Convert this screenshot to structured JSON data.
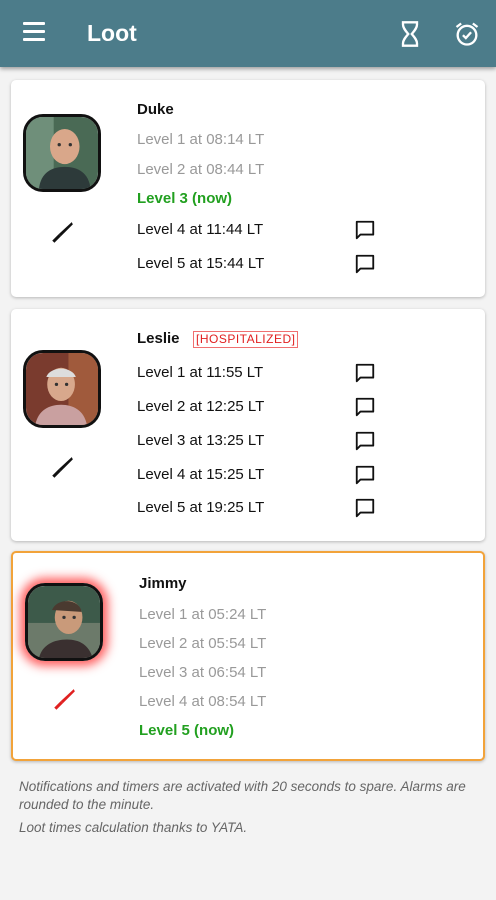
{
  "appbar": {
    "title": "Loot",
    "icons": {
      "menu": "menu-icon",
      "timer": "hourglass-icon",
      "alarm": "alarm-clock-icon"
    },
    "color": "#4c7c8a"
  },
  "colors": {
    "past": "#999999",
    "now": "#22a020",
    "hospitalized": "#e02020",
    "highlight_border": "#f2a33a"
  },
  "npcs": [
    {
      "name": "Duke",
      "badge": "",
      "levels": [
        {
          "label": "Level 1 at 08:14 LT",
          "state": "past"
        },
        {
          "label": "Level 2 at 08:44 LT",
          "state": "past"
        },
        {
          "label": "Level 3 (now)",
          "state": "now"
        },
        {
          "label": "Level 4 at 11:44 LT",
          "state": "future",
          "notify_icon": "chat-bubble-icon"
        },
        {
          "label": "Level 5 at 15:44 LT",
          "state": "future",
          "notify_icon": "chat-bubble-icon"
        }
      ]
    },
    {
      "name": "Leslie",
      "badge": "[HOSPITALIZED]",
      "levels": [
        {
          "label": "Level 1 at 11:55 LT",
          "state": "future",
          "notify_icon": "chat-bubble-icon"
        },
        {
          "label": "Level 2 at 12:25 LT",
          "state": "future",
          "notify_icon": "chat-bubble-icon"
        },
        {
          "label": "Level 3 at 13:25 LT",
          "state": "future",
          "notify_icon": "chat-bubble-icon"
        },
        {
          "label": "Level 4 at 15:25 LT",
          "state": "future",
          "notify_icon": "chat-bubble-icon"
        },
        {
          "label": "Level 5 at 19:25 LT",
          "state": "future",
          "notify_icon": "chat-bubble-icon"
        }
      ]
    },
    {
      "name": "Jimmy",
      "badge": "",
      "highlighted": true,
      "levels": [
        {
          "label": "Level 1 at 05:24 LT",
          "state": "past"
        },
        {
          "label": "Level 2 at 05:54 LT",
          "state": "past"
        },
        {
          "label": "Level 3 at 06:54 LT",
          "state": "past"
        },
        {
          "label": "Level 4 at 08:54 LT",
          "state": "past"
        },
        {
          "label": "Level 5 (now)",
          "state": "now"
        }
      ]
    }
  ],
  "footer": {
    "note1": "Notifications and timers are activated with 20 seconds to spare. Alarms are rounded to the minute.",
    "note2": "Loot times calculation thanks to YATA."
  }
}
